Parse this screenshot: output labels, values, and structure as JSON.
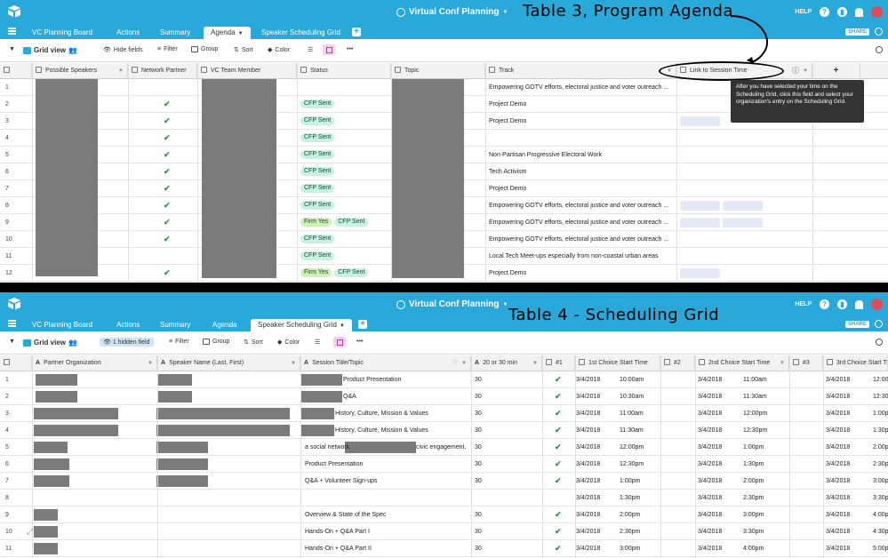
{
  "brand_color": "#29a8da",
  "top": {
    "base_name": "Virtual Conf Planning",
    "help_label": "HELP",
    "share_label": "SHARE"
  },
  "tables": [
    "VC Planning Board",
    "Actions",
    "Summary",
    "Agenda",
    "Speaker Scheduling Grid"
  ],
  "annotations": {
    "table3": "Table 3, Program Agenda",
    "table4": "Table 4 - Scheduling Grid"
  },
  "view1": {
    "active_table": "Agenda",
    "view_name": "Grid view",
    "toolbar": {
      "hide_fields": "Hide fields",
      "filter": "Filter",
      "group": "Group",
      "sort": "Sort",
      "color": "Color"
    },
    "columns": [
      "Possible Speakers",
      "Network Partner",
      "VC Team Member",
      "Status",
      "Topic",
      "Track",
      "Link to Session Time"
    ],
    "tooltip": "After you have selected your time on the Scheduling Grid, click this field and select your organization's entry on the Scheduling Grid.",
    "rows": [
      {
        "n": "1",
        "partner": false,
        "status": [],
        "track": "Empowering GOTV efforts, electoral justice and voter outreach ...",
        "links": 0
      },
      {
        "n": "2",
        "partner": true,
        "status": [
          "CFP Sent"
        ],
        "track": "Project Demo",
        "links": 0
      },
      {
        "n": "3",
        "partner": true,
        "status": [
          "CFP Sent"
        ],
        "track": "Project Demo",
        "links": 1
      },
      {
        "n": "4",
        "partner": true,
        "status": [
          "CFP Sent"
        ],
        "track": "",
        "links": 0
      },
      {
        "n": "5",
        "partner": true,
        "status": [
          "CFP Sent"
        ],
        "track": "Non-Partisan Progressive Electoral Work",
        "links": 0
      },
      {
        "n": "6",
        "partner": true,
        "status": [
          "CFP Sent"
        ],
        "track": "Tech Activism",
        "links": 0
      },
      {
        "n": "7",
        "partner": true,
        "status": [
          "CFP Sent"
        ],
        "track": "Project Demo",
        "links": 0
      },
      {
        "n": "8",
        "partner": true,
        "status": [
          "CFP Sent"
        ],
        "track": "Empowering GOTV efforts, electoral justice and voter outreach ...",
        "links": 2
      },
      {
        "n": "9",
        "partner": true,
        "status": [
          "Firm Yes",
          "CFP Sent"
        ],
        "track": "Empowering GOTV efforts, electoral justice and voter outreach ...",
        "links": 2
      },
      {
        "n": "10",
        "partner": true,
        "status": [
          "CFP Sent"
        ],
        "track": "Empowering GOTV efforts, electoral justice and voter outreach ...",
        "links": 0
      },
      {
        "n": "11",
        "partner": false,
        "status": [
          "CFP Sent"
        ],
        "track": "Local Tech Meet-ups especially from non-coastal urban areas",
        "links": 0
      },
      {
        "n": "12",
        "partner": true,
        "status": [
          "Firm Yes",
          "CFP Sent"
        ],
        "track": "Project Demo",
        "links": 1
      }
    ]
  },
  "view2": {
    "active_table": "Speaker Scheduling Grid",
    "view_name": "Grid view",
    "toolbar": {
      "hidden_field": "1 hidden field",
      "filter": "Filter",
      "group": "Group",
      "sort": "Sort",
      "color": "Color"
    },
    "columns": [
      "Partner Organization",
      "Speaker Name (Last, First)",
      "Session Title/Topic",
      "20 or 30 min",
      "#1",
      "1st Choice Start Time",
      "#2",
      "2nd Choice Start Time",
      "#3",
      "3rd Choice Start Ti"
    ],
    "rows": [
      {
        "n": "1",
        "title": "Product Presentation",
        "min": "30",
        "c1": true,
        "d1": "3/4/2018",
        "t1": "10:00am",
        "d2": "3/4/2018",
        "t2": "11:00am",
        "d3": "3/4/2018",
        "t3": "12:00"
      },
      {
        "n": "2",
        "title": "Q&A",
        "min": "30",
        "c1": true,
        "d1": "3/4/2018",
        "t1": "10:30am",
        "d2": "3/4/2018",
        "t2": "11:30am",
        "d3": "3/4/2018",
        "t3": "12:30"
      },
      {
        "n": "3",
        "title": "History, Culture, Mission & Values",
        "min": "30",
        "c1": true,
        "d1": "3/4/2018",
        "t1": "11:00am",
        "d2": "3/4/2018",
        "t2": "12:00pm",
        "d3": "3/4/2018",
        "t3": "1:00p"
      },
      {
        "n": "4",
        "title": "History, Culture, Mission & Values",
        "min": "30",
        "c1": true,
        "d1": "3/4/2018",
        "t1": "11:30am",
        "d2": "3/4/2018",
        "t2": "12:30pm",
        "d3": "3/4/2018",
        "t3": "1:30p"
      },
      {
        "n": "5",
        "title": "a social network",
        "title_tail": "civic engagement.",
        "min": "30",
        "c1": true,
        "d1": "3/4/2018",
        "t1": "12:00pm",
        "d2": "3/4/2018",
        "t2": "1:00pm",
        "d3": "3/4/2018",
        "t3": "2:00p"
      },
      {
        "n": "6",
        "title": "Product Presentation",
        "min": "30",
        "c1": true,
        "d1": "3/4/2018",
        "t1": "12:30pm",
        "d2": "3/4/2018",
        "t2": "1:30pm",
        "d3": "3/4/2018",
        "t3": "2:30p"
      },
      {
        "n": "7",
        "title": "Q&A + Volunteer Sign-ups",
        "min": "30",
        "c1": true,
        "d1": "3/4/2018",
        "t1": "1:00pm",
        "d2": "3/4/2018",
        "t2": "2:00pm",
        "d3": "3/4/2018",
        "t3": "3:00p"
      },
      {
        "n": "8",
        "title": "",
        "min": "",
        "c1": false,
        "d1": "3/4/2018",
        "t1": "1:30pm",
        "d2": "3/4/2018",
        "t2": "2:30pm",
        "d3": "3/4/2018",
        "t3": "3:30p"
      },
      {
        "n": "9",
        "title": "Overview & State of the Spec",
        "min": "30",
        "c1": true,
        "d1": "3/4/2018",
        "t1": "2:00pm",
        "d2": "3/4/2018",
        "t2": "3:00pm",
        "d3": "3/4/2018",
        "t3": "4:00p"
      },
      {
        "n": "10",
        "title": "Hands-On + Q&A Part I",
        "min": "30",
        "c1": true,
        "d1": "3/4/2018",
        "t1": "2:30pm",
        "d2": "3/4/2018",
        "t2": "3:30pm",
        "d3": "3/4/2018",
        "t3": "4:30p"
      },
      {
        "n": "11",
        "title": "Hands-On + Q&A Part II",
        "min": "30",
        "c1": true,
        "d1": "3/4/2018",
        "t1": "3:00pm",
        "d2": "3/4/2018",
        "t2": "4:00pm",
        "d3": "3/4/2018",
        "t3": "5:00p"
      }
    ]
  }
}
